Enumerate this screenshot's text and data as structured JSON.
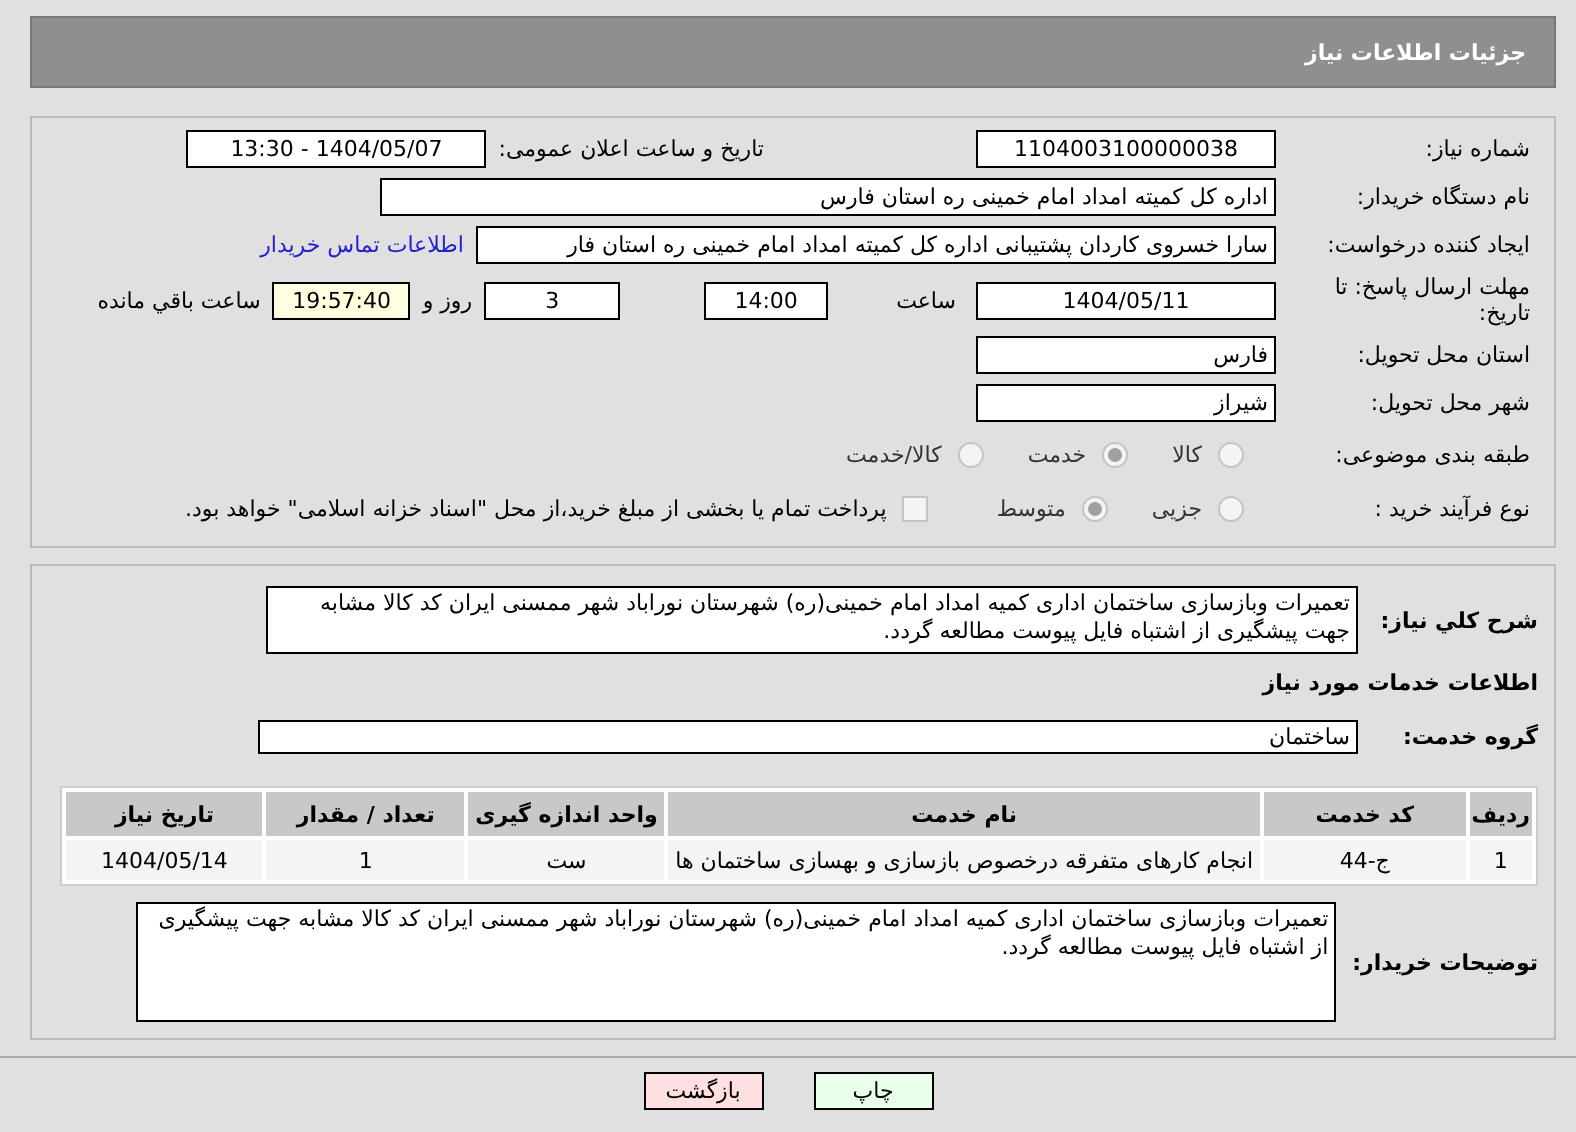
{
  "header": {
    "title": "جزئیات اطلاعات نیاز"
  },
  "need_info": {
    "need_number": {
      "label": "شماره نیاز:",
      "value": "1104003100000038"
    },
    "announce": {
      "label": "تاریخ و ساعت اعلان عمومی:",
      "value": "1404/05/07 - 13:30"
    },
    "buyer": {
      "label": "نام دستگاه خریدار:",
      "value": "اداره کل کمیته امداد امام خمینی  ره  استان فارس"
    },
    "creator": {
      "label": "ایجاد کننده درخواست:",
      "value": "سارا خسروی کاردان پشتیبانی  اداره کل کمیته امداد امام خمینی  ره  استان فار",
      "link": "اطلاعات تماس خریدار"
    },
    "deadline": {
      "label": "مهلت ارسال پاسخ: تا تاریخ:",
      "date": "1404/05/11",
      "time_label": "ساعت",
      "time": "14:00",
      "days": "3",
      "days_label": "روز و",
      "remaining": "19:57:40",
      "remaining_label": "ساعت باقي مانده"
    },
    "province": {
      "label": "استان محل تحویل:",
      "value": "فارس"
    },
    "city": {
      "label": "شهر محل تحویل:",
      "value": "شیراز"
    },
    "category": {
      "label": "طبقه بندی موضوعی:",
      "options": [
        {
          "label": "کالا",
          "selected": false
        },
        {
          "label": "خدمت",
          "selected": true
        },
        {
          "label": "کالا/خدمت",
          "selected": false
        }
      ]
    },
    "process": {
      "label": "نوع فرآیند خرید :",
      "options": [
        {
          "label": "جزیی",
          "selected": false
        },
        {
          "label": "متوسط",
          "selected": true
        }
      ],
      "treasury": {
        "checked": false,
        "text": "پرداخت تمام یا بخشی از مبلغ خرید،از محل \"اسناد خزانه اسلامی\" خواهد بود."
      }
    }
  },
  "services": {
    "description": {
      "label": "شرح کلي نياز:",
      "value": "تعمیرات وبازسازی ساختمان اداری کمیه امداد امام خمینی(ره) شهرستان نوراباد  شهر ممسنی ایران کد کالا مشابه جهت پیشگیری از اشتباه فایل پیوست مطالعه گردد."
    },
    "section_title": "اطلاعات خدمات مورد نیاز",
    "group": {
      "label": "گروه خدمت:",
      "value": "ساختمان"
    },
    "table": {
      "columns": [
        "ردیف",
        "کد خدمت",
        "نام خدمت",
        "واحد اندازه گیری",
        "تعداد / مقدار",
        "تاریخ نیاز"
      ],
      "rows": [
        [
          "1",
          "ج-44",
          "انجام کارهای متفرقه درخصوص بازسازی و بهسازی ساختمان ها",
          "ست",
          "1",
          "1404/05/14"
        ]
      ]
    },
    "notes": {
      "label": "توضیحات خریدار:",
      "value": "تعمیرات وبازسازی ساختمان اداری کمیه امداد امام خمینی(ره) شهرستان نوراباد  شهر ممسنی ایران کد کالا مشابه جهت پیشگیری از اشتباه فایل پیوست مطالعه گردد."
    }
  },
  "buttons": [
    {
      "kind": "print",
      "label": "چاپ"
    },
    {
      "kind": "back",
      "label": "بازگشت"
    }
  ]
}
